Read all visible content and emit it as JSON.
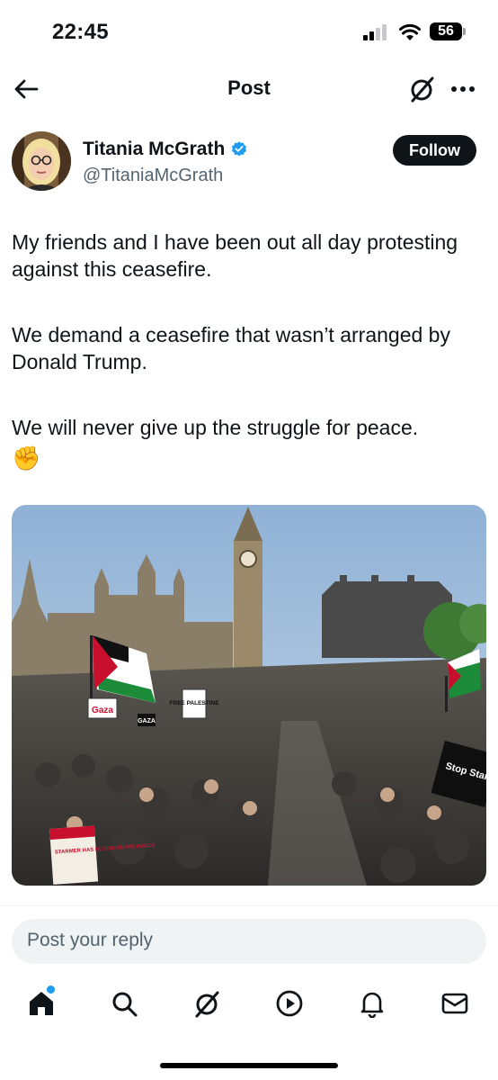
{
  "status_bar": {
    "time": "22:45",
    "battery": "56"
  },
  "header": {
    "title": "Post"
  },
  "author": {
    "display_name": "Titania McGrath",
    "handle": "@TitaniaMcGrath",
    "verified": true,
    "follow_label": "Follow"
  },
  "post": {
    "paragraphs": [
      "My friends and I have been out all day protesting against this ceasefire.",
      "We demand a ceasefire that wasn’t arranged by Donald Trump.",
      "We will never give up the struggle for peace."
    ],
    "emoji": "✊"
  },
  "media": {
    "signs": [
      "Gaza",
      "FREE PALESTINE",
      "GAZA",
      "Stop Starving GAZA",
      "STARMER HAS BLOOD ON HIS HANDS"
    ]
  },
  "reply": {
    "placeholder": "Post your reply"
  },
  "tab_bar": {
    "items": [
      "home-icon",
      "search-icon",
      "grok-icon",
      "video-icon",
      "notifications-icon",
      "messages-icon"
    ]
  },
  "colors": {
    "accent": "#1d9bf0",
    "text": "#0f1419",
    "muted": "#536471",
    "input_bg": "#eff3f4"
  }
}
